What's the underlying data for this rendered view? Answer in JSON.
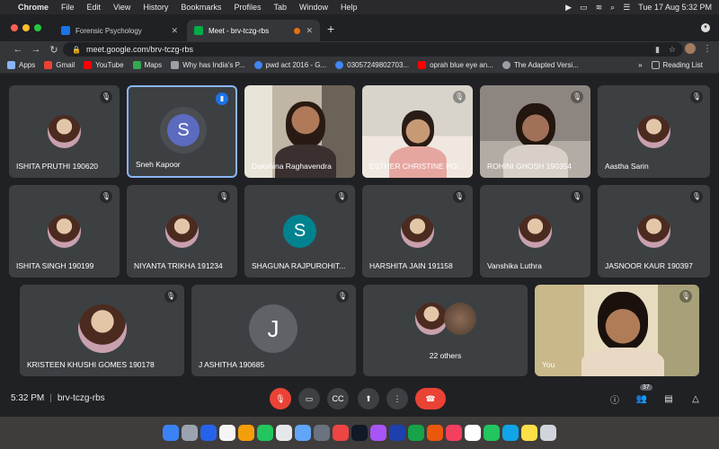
{
  "menubar": {
    "app_name": "Chrome",
    "menus": [
      "File",
      "Edit",
      "View",
      "History",
      "Bookmarks",
      "Profiles",
      "Tab",
      "Window",
      "Help"
    ],
    "clock": "Tue 17 Aug  5:32 PM"
  },
  "tabs": [
    {
      "title": "Forensic Psychology",
      "favicon_color": "#1a73e8"
    },
    {
      "title": "Meet - brv-tczg-rbs",
      "favicon_color": "#00ac47"
    }
  ],
  "address_bar": {
    "url": "meet.google.com/brv-tczg-rbs"
  },
  "bookmarks": {
    "items": [
      {
        "label": "Apps",
        "icon": "apps-grid-icon",
        "color": "#8ab4f8"
      },
      {
        "label": "Gmail",
        "icon": "gmail-icon",
        "color": "#ea4335"
      },
      {
        "label": "YouTube",
        "icon": "youtube-icon",
        "color": "#ff0000"
      },
      {
        "label": "Maps",
        "icon": "maps-icon",
        "color": "#34a853"
      },
      {
        "label": "Why has India's P...",
        "icon": "dots-icon",
        "color": "#9aa0a6"
      },
      {
        "label": "pwd act 2016 - G...",
        "icon": "google-icon",
        "color": "#4285f4"
      },
      {
        "label": "03057249802703...",
        "icon": "google-icon",
        "color": "#4285f4"
      },
      {
        "label": "oprah blue eye an...",
        "icon": "youtube-icon",
        "color": "#ff0000"
      },
      {
        "label": "The Adapted Versi...",
        "icon": "globe-icon",
        "color": "#9aa0a6"
      }
    ],
    "more": "»",
    "reading_list": "Reading List"
  },
  "participants": [
    {
      "name": "ISHITA PRUTHI 190620",
      "kind": "avatar",
      "muted": true
    },
    {
      "name": "Sneh Kapoor",
      "kind": "letter",
      "letter": "S",
      "letter_bg": "#5c6bc0",
      "muted": false,
      "speaking": true
    },
    {
      "name": "Dakshina Raghavendra",
      "kind": "video",
      "muted": false
    },
    {
      "name": "ESTHER CHRISTINE PO...",
      "kind": "video",
      "muted": true
    },
    {
      "name": "ROHINI GHOSH 190354",
      "kind": "video",
      "muted": true
    },
    {
      "name": "Aastha Sarin",
      "kind": "avatar",
      "muted": true
    },
    {
      "name": "ISHITA SINGH 190199",
      "kind": "avatar",
      "muted": true
    },
    {
      "name": "NIYANTA TRIKHA 191234",
      "kind": "avatar",
      "muted": true
    },
    {
      "name": "SHAGUNA RAJPUROHIT...",
      "kind": "letter",
      "letter": "S",
      "letter_bg": "#00838f",
      "muted": true
    },
    {
      "name": "HARSHITA JAIN 191158",
      "kind": "avatar",
      "muted": true
    },
    {
      "name": "Vanshika Luthra",
      "kind": "avatar",
      "muted": true
    },
    {
      "name": "JASNOOR KAUR 190397",
      "kind": "avatar",
      "muted": true
    },
    {
      "name": "KRISTEEN KHUSHI GOMES 190178",
      "kind": "avatar",
      "muted": true
    },
    {
      "name": "J ASHITHA 190685",
      "kind": "letter",
      "letter": "J",
      "letter_bg": "#5f6368",
      "muted": true
    },
    {
      "name": "22 others",
      "kind": "group",
      "muted": true
    },
    {
      "name": "You",
      "kind": "video",
      "muted": true
    }
  ],
  "controls": {
    "time": "5:32 PM",
    "separator": "|",
    "meeting_code": "brv-tczg-rbs",
    "participant_count": "37"
  },
  "colors": {
    "end_call": "#ea4335",
    "mic_off": "#ea4335",
    "speaking_border": "#8ab4f8"
  }
}
